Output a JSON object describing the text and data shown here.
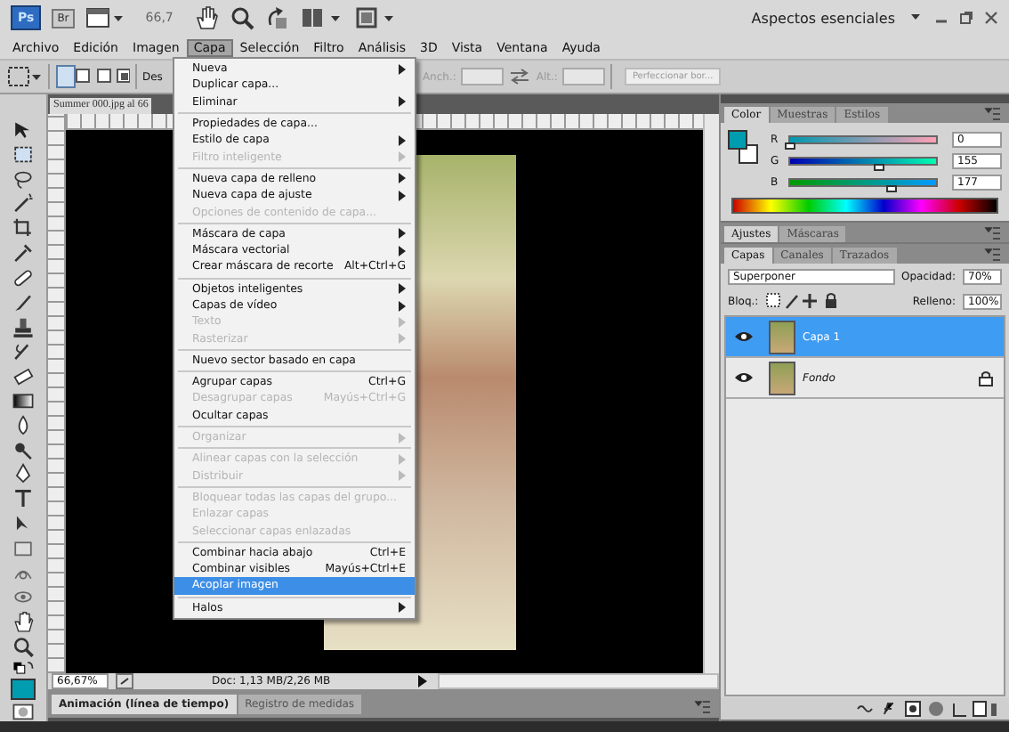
{
  "app_bar": {
    "logo": "Ps",
    "bridge": "Br",
    "zoom": "66,7",
    "workspace": "Aspectos esenciales"
  },
  "menu_bar": [
    {
      "label": "Archivo",
      "selected": false
    },
    {
      "label": "Edición",
      "selected": false
    },
    {
      "label": "Imagen",
      "selected": false
    },
    {
      "label": "Capa",
      "selected": true
    },
    {
      "label": "Selección",
      "selected": false
    },
    {
      "label": "Filtro",
      "selected": false
    },
    {
      "label": "Análisis",
      "selected": false
    },
    {
      "label": "3D",
      "selected": false
    },
    {
      "label": "Vista",
      "selected": false
    },
    {
      "label": "Ventana",
      "selected": false
    },
    {
      "label": "Ayuda",
      "selected": false
    }
  ],
  "options_bar": {
    "feather_label": "Des",
    "width_label": "Anch.:",
    "height_label": "Alt.:",
    "refine_button": "Perfeccionar bor..."
  },
  "document": {
    "tab": "Summer 000.jpg al 66",
    "zoom": "66,67%",
    "doc_size": "Doc: 1,13 MB/2,26 MB"
  },
  "bottom_tabs": [
    {
      "label": "Animación (línea de tiempo)",
      "selected": true
    },
    {
      "label": "Registro de medidas",
      "selected": false
    }
  ],
  "layer_menu": [
    {
      "kind": "item",
      "label": "Nueva",
      "submenu": true,
      "disabled": false,
      "selected": false
    },
    {
      "kind": "item",
      "label": "Duplicar capa...",
      "submenu": false,
      "disabled": false,
      "selected": false
    },
    {
      "kind": "item",
      "label": "Eliminar",
      "submenu": true,
      "disabled": false,
      "selected": false
    },
    {
      "kind": "separator"
    },
    {
      "kind": "item",
      "label": "Propiedades de capa...",
      "submenu": false,
      "disabled": false,
      "selected": false
    },
    {
      "kind": "item",
      "label": "Estilo de capa",
      "submenu": true,
      "disabled": false,
      "selected": false
    },
    {
      "kind": "item",
      "label": "Filtro inteligente",
      "submenu": true,
      "disabled": true,
      "selected": false
    },
    {
      "kind": "separator"
    },
    {
      "kind": "item",
      "label": "Nueva capa de relleno",
      "submenu": true,
      "disabled": false,
      "selected": false
    },
    {
      "kind": "item",
      "label": "Nueva capa de ajuste",
      "submenu": true,
      "disabled": false,
      "selected": false
    },
    {
      "kind": "item",
      "label": "Opciones de contenido de capa...",
      "submenu": false,
      "disabled": true,
      "selected": false
    },
    {
      "kind": "separator"
    },
    {
      "kind": "item",
      "label": "Máscara de capa",
      "submenu": true,
      "disabled": false,
      "selected": false
    },
    {
      "kind": "item",
      "label": "Máscara vectorial",
      "submenu": true,
      "disabled": false,
      "selected": false
    },
    {
      "kind": "item",
      "label": "Crear máscara de recorte",
      "shortcut": "Alt+Ctrl+G",
      "submenu": false,
      "disabled": false,
      "selected": false
    },
    {
      "kind": "separator"
    },
    {
      "kind": "item",
      "label": "Objetos inteligentes",
      "submenu": true,
      "disabled": false,
      "selected": false
    },
    {
      "kind": "item",
      "label": "Capas de vídeo",
      "submenu": true,
      "disabled": false,
      "selected": false
    },
    {
      "kind": "item",
      "label": "Texto",
      "submenu": true,
      "disabled": true,
      "selected": false
    },
    {
      "kind": "item",
      "label": "Rasterizar",
      "submenu": true,
      "disabled": true,
      "selected": false
    },
    {
      "kind": "separator"
    },
    {
      "kind": "item",
      "label": "Nuevo sector basado en capa",
      "submenu": false,
      "disabled": false,
      "selected": false
    },
    {
      "kind": "separator"
    },
    {
      "kind": "item",
      "label": "Agrupar capas",
      "shortcut": "Ctrl+G",
      "submenu": false,
      "disabled": false,
      "selected": false
    },
    {
      "kind": "item",
      "label": "Desagrupar capas",
      "shortcut": "Mayús+Ctrl+G",
      "submenu": false,
      "disabled": true,
      "selected": false
    },
    {
      "kind": "item",
      "label": "Ocultar capas",
      "submenu": false,
      "disabled": false,
      "selected": false
    },
    {
      "kind": "separator"
    },
    {
      "kind": "item",
      "label": "Organizar",
      "submenu": true,
      "disabled": true,
      "selected": false
    },
    {
      "kind": "separator"
    },
    {
      "kind": "item",
      "label": "Alinear capas con la selección",
      "submenu": true,
      "disabled": true,
      "selected": false
    },
    {
      "kind": "item",
      "label": "Distribuir",
      "submenu": true,
      "disabled": true,
      "selected": false
    },
    {
      "kind": "separator"
    },
    {
      "kind": "item",
      "label": "Bloquear todas las capas del grupo...",
      "submenu": false,
      "disabled": true,
      "selected": false
    },
    {
      "kind": "item",
      "label": "Enlazar capas",
      "submenu": false,
      "disabled": true,
      "selected": false
    },
    {
      "kind": "item",
      "label": "Seleccionar capas enlazadas",
      "submenu": false,
      "disabled": true,
      "selected": false
    },
    {
      "kind": "separator"
    },
    {
      "kind": "item",
      "label": "Combinar hacia abajo",
      "shortcut": "Ctrl+E",
      "submenu": false,
      "disabled": false,
      "selected": false
    },
    {
      "kind": "item",
      "label": "Combinar visibles",
      "shortcut": "Mayús+Ctrl+E",
      "submenu": false,
      "disabled": false,
      "selected": false
    },
    {
      "kind": "item",
      "label": "Acoplar imagen",
      "submenu": false,
      "disabled": false,
      "selected": true
    },
    {
      "kind": "separator"
    },
    {
      "kind": "item",
      "label": "Halos",
      "submenu": true,
      "disabled": false,
      "selected": false
    }
  ],
  "color_panel": {
    "tabs": [
      {
        "label": "Color",
        "selected": true
      },
      {
        "label": "Muestras",
        "selected": false
      },
      {
        "label": "Estilos",
        "selected": false
      }
    ],
    "channels": [
      {
        "name": "R",
        "level": 0,
        "value": "0"
      },
      {
        "name": "G",
        "level": 0.61,
        "value": "155"
      },
      {
        "name": "B",
        "level": 0.69,
        "value": "177"
      }
    ]
  },
  "adjust_panel": {
    "tabs": [
      {
        "label": "Ajustes",
        "selected": true
      },
      {
        "label": "Máscaras",
        "selected": false
      }
    ]
  },
  "layers_panel": {
    "tabs": [
      {
        "label": "Capas",
        "selected": true
      },
      {
        "label": "Canales",
        "selected": false
      },
      {
        "label": "Trazados",
        "selected": false
      }
    ],
    "blend_mode": "Superponer",
    "opacity_label": "Opacidad:",
    "opacity": "70%",
    "lock_label": "Bloq.:",
    "fill_label": "Relleno:",
    "fill": "100%",
    "layers": [
      {
        "name": "Capa 1",
        "selected": true,
        "locked": false,
        "visible": true
      },
      {
        "name": "Fondo",
        "selected": false,
        "locked": true,
        "visible": true
      }
    ]
  }
}
